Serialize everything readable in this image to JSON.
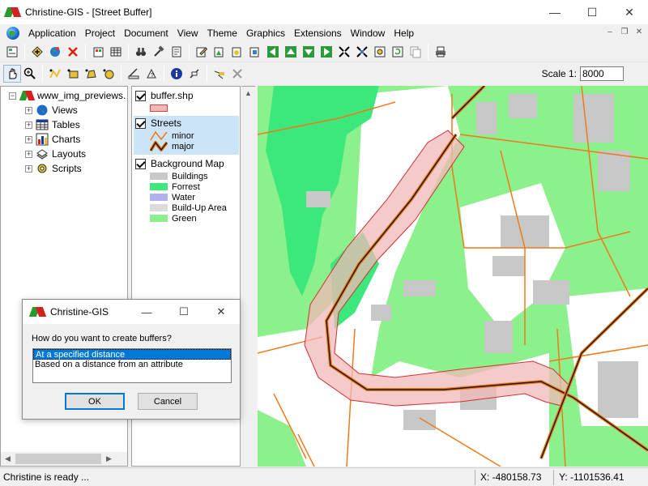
{
  "window": {
    "title": "Christine-GIS - [Street Buffer]",
    "minimize": "—",
    "maximize": "☐",
    "close": "✕"
  },
  "menu": [
    "Application",
    "Project",
    "Document",
    "View",
    "Theme",
    "Graphics",
    "Extensions",
    "Window",
    "Help"
  ],
  "mdi": {
    "minimize": "–",
    "restore": "❐",
    "close": "✕"
  },
  "scale": {
    "label": "Scale 1:",
    "value": "8000"
  },
  "tree": {
    "root": "www_img_previews.",
    "items": [
      "Views",
      "Tables",
      "Charts",
      "Layouts",
      "Scripts"
    ],
    "expander": "+"
  },
  "legend": {
    "themes": [
      {
        "name": "buffer.shp",
        "entries": [
          ""
        ]
      },
      {
        "name": "Streets",
        "entries": [
          "minor",
          "major"
        ]
      },
      {
        "name": "Background Map",
        "entries": [
          "Buildings",
          "Forrest",
          "Water",
          "Build-Up Area",
          "Green"
        ]
      }
    ],
    "colors": {
      "buffer": "#f2b8b8",
      "buildings": "#c8c8c8",
      "forrest": "#3ce87c",
      "water": "#b0b0f0",
      "buildup": "#dcdcdc",
      "green": "#8cf08c",
      "minor": "#f07a1a",
      "major": "#1a1a1a"
    }
  },
  "status": {
    "message": "Christine is ready ...",
    "x": "X: -480158.73",
    "y": "Y: -1101536.41"
  },
  "dialog": {
    "title": "Christine-GIS",
    "prompt": "How do you want to create buffers?",
    "options": [
      "At a specified distance",
      "Based on a distance from an attribute"
    ],
    "ok": "OK",
    "cancel": "Cancel"
  }
}
